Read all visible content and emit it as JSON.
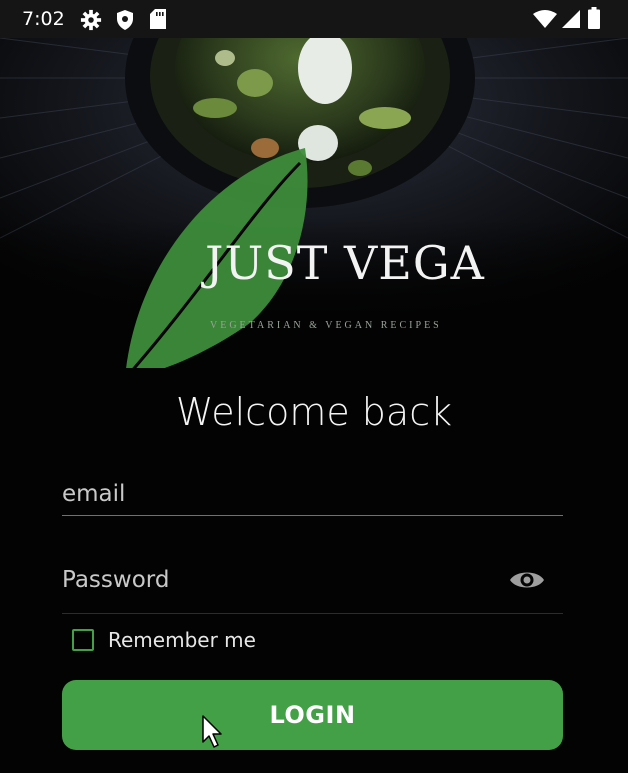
{
  "status_bar": {
    "time": "7:02",
    "icons_left": [
      "gear-icon",
      "shield-icon",
      "sd-card-icon"
    ],
    "icons_right": [
      "wifi-icon",
      "signal-icon",
      "battery-icon"
    ]
  },
  "brand": {
    "title": "JUST VEGA",
    "tagline": "VEGETARIAN & VEGAN RECIPES",
    "accent_color": "#3d8c3a"
  },
  "welcome": "Welcome back",
  "form": {
    "email_placeholder": "email",
    "password_placeholder": "Password",
    "remember_label": "Remember me",
    "remember_checked": false,
    "login_label": "LOGIN"
  },
  "colors": {
    "primary": "#43a047",
    "background": "#030303"
  }
}
